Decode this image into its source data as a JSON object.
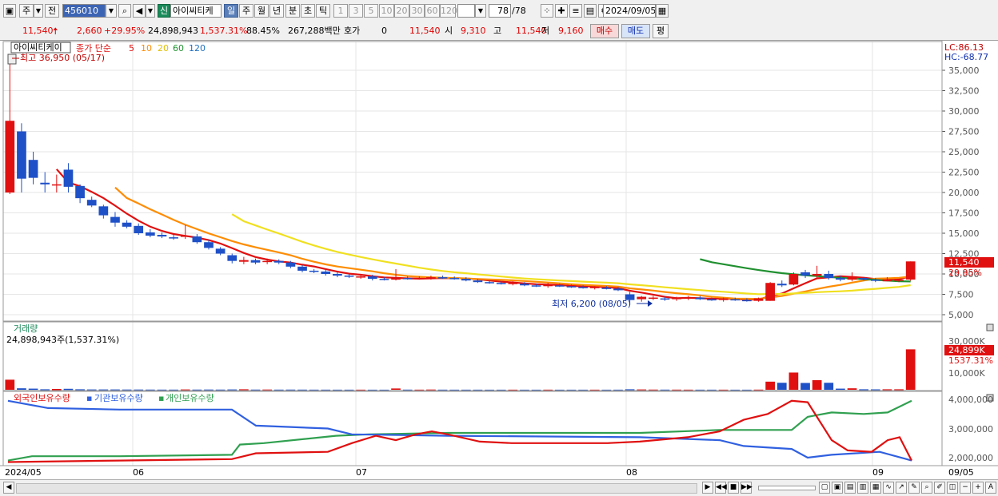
{
  "toolbar": {
    "period_select": "주",
    "prev_label": "전",
    "stock_code": "456010",
    "new_badge": "신",
    "stock_name": "아이씨티케",
    "periods": [
      "일",
      "주",
      "월",
      "년",
      "분",
      "초",
      "틱"
    ],
    "active_period": "일",
    "intervals": [
      "1",
      "3",
      "5",
      "10",
      "20",
      "30",
      "60",
      "120"
    ],
    "count_value": "78",
    "count_total": "/78",
    "date_value": "2024/09/05"
  },
  "quote": {
    "price": "11,540",
    "change": "2,660",
    "change_pct": "+29.95%",
    "volume": "24,898,943",
    "volume_ratio": "1,537.31%",
    "turnover_pct": "88.45%",
    "amount": "267,288백만",
    "hoga_label": "호가",
    "hoga_value": "0",
    "hoga_price": "11,540",
    "open_label": "시",
    "open": "9,310",
    "high_label": "고",
    "high": "11,540",
    "low_label": "저",
    "low": "9,160",
    "buy_label": "매수",
    "sell_label": "매도",
    "eval_label": "평"
  },
  "chart": {
    "price_title": "아이씨티케이",
    "ma_label": "종가 단순",
    "ma_periods": [
      "5",
      "10",
      "20",
      "60",
      "120"
    ],
    "max_label": "최고 36,950 (05/17)",
    "min_label": "최저 6,200 (08/05)",
    "lc_label": "LC:86.13",
    "hc_label": "HC:-68.77",
    "price_ticks": [
      "35,000",
      "32,500",
      "30,000",
      "27,500",
      "25,000",
      "22,500",
      "20,000",
      "17,500",
      "15,000",
      "12,500",
      "10,000",
      "7,500",
      "5,000"
    ],
    "last_price_tag": "11,540",
    "last_pct_tag": "29.95%",
    "volume_title": "거래량",
    "volume_sub": "24,898,943주(1,537.31%)",
    "volume_ticks": [
      "30,000K",
      "10,000K"
    ],
    "volume_tag": "24,899K",
    "volume_pct_tag": "1537.31%",
    "holder_legend": [
      "외국인보유수량",
      "기관보유수량",
      "개인보유수량"
    ],
    "holder_ticks": [
      "4,000,000",
      "3,000,000",
      "2,000,000"
    ],
    "date_labels": [
      "2024/05",
      "06",
      "07",
      "08",
      "09"
    ],
    "right_date": "09/05",
    "colors": {
      "up": "#e01010",
      "down": "#1e50c8",
      "ma5": "#e01010",
      "ma10": "#ff8c00",
      "ma20": "#f0e020",
      "ma60": "#209030",
      "ma120": "#2070c0",
      "foreign": "#e01010",
      "institution": "#3060e0",
      "individual": "#30a050"
    }
  }
}
